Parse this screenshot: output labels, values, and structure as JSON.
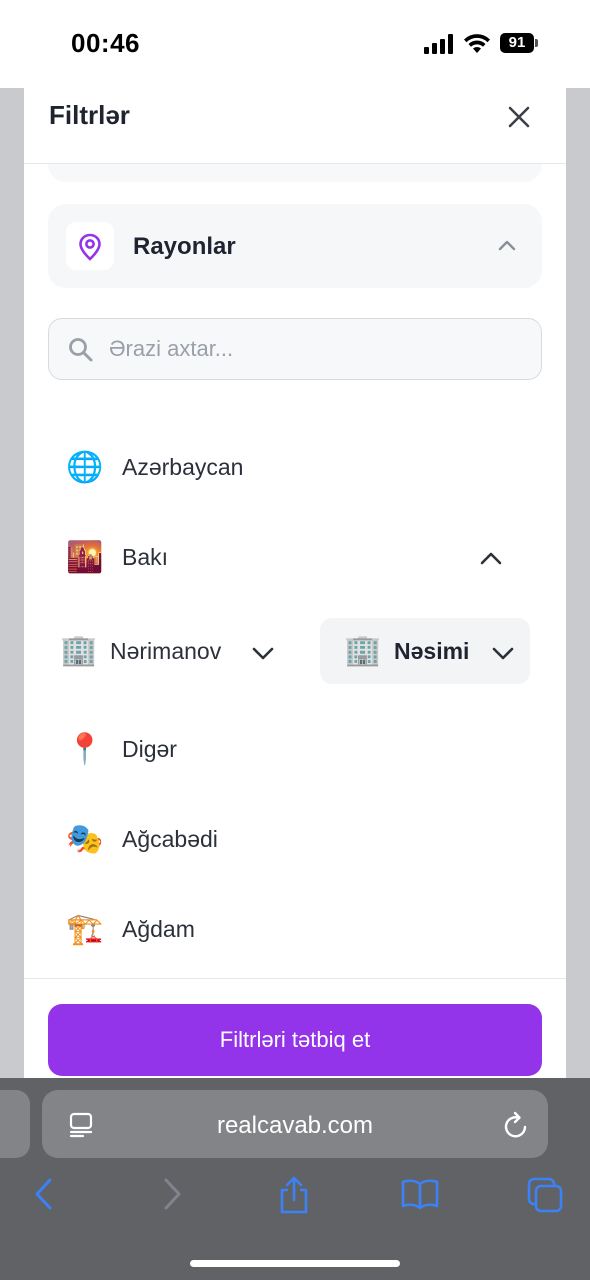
{
  "status_bar": {
    "time": "00:46",
    "battery": "91"
  },
  "panel": {
    "title": "Filtrlər",
    "section": {
      "label": "Rayonlar"
    },
    "search": {
      "placeholder": "Ərazi axtar..."
    },
    "locations": [
      {
        "icon": "globe-icon",
        "emoji": "🌐",
        "label": "Azərbaycan"
      },
      {
        "icon": "city-icon",
        "emoji": "🌇",
        "label": "Bakı"
      },
      {
        "icon": "pin-icon",
        "emoji": "📍",
        "label": "Digər"
      },
      {
        "icon": "theater-icon",
        "emoji": "🎭",
        "label": "Ağcabədi"
      },
      {
        "icon": "crane-icon",
        "emoji": "🏗️",
        "label": "Ağdam"
      }
    ],
    "sub_locations": [
      {
        "icon": "building-icon",
        "emoji": "🏢",
        "label": "Nərimanov"
      },
      {
        "icon": "building-icon",
        "emoji": "🏢",
        "label": "Nəsimi"
      }
    ],
    "apply_label": "Filtrləri tətbiq et"
  },
  "browser": {
    "url": "realcavab.com"
  },
  "colors": {
    "accent": "#9333ea",
    "pin": "#9333ea"
  }
}
